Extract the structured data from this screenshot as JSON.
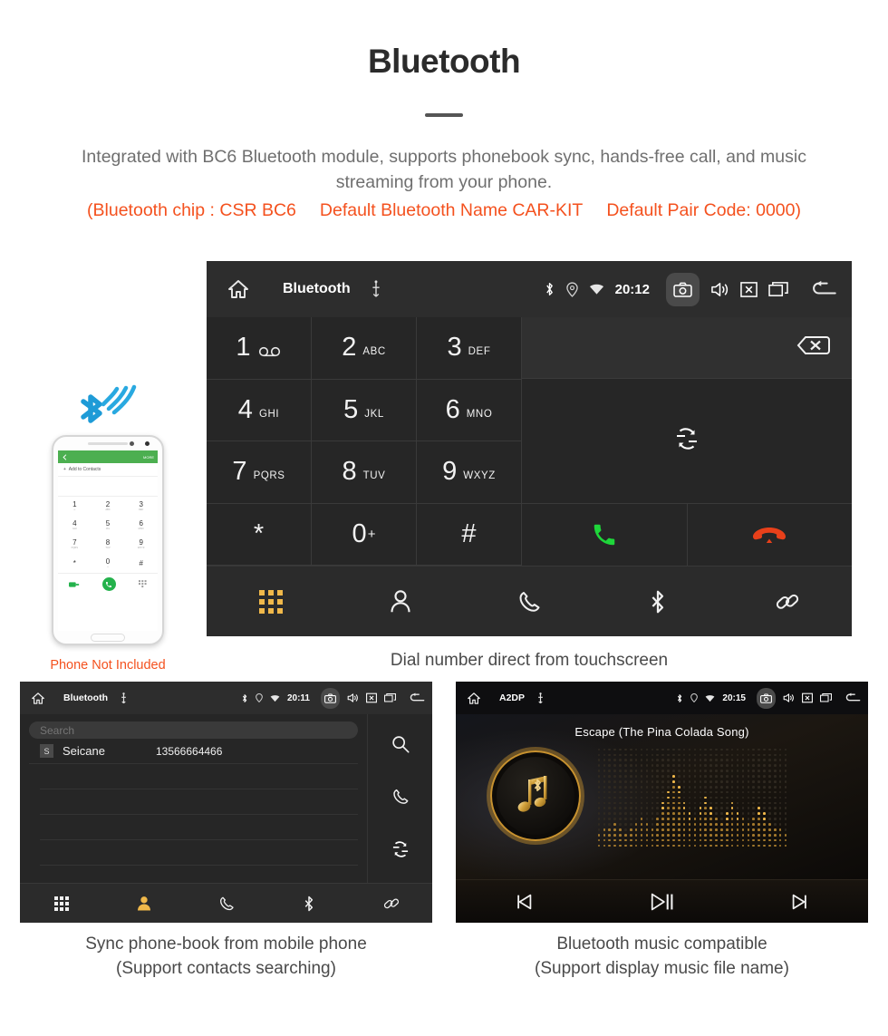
{
  "header": {
    "title": "Bluetooth",
    "description": "Integrated with BC6 Bluetooth module, supports phonebook sync, hands-free call, and music streaming from your phone.",
    "spec_open": "(Bluetooth chip : CSR BC6",
    "spec_name": "Default Bluetooth Name CAR-KIT",
    "spec_pair": "Default Pair Code: 0000)",
    "accent_color": "#f4511e",
    "body_color": "#6f6f6f"
  },
  "dialer": {
    "statusbar": {
      "home_icon": "home-icon",
      "title": "Bluetooth",
      "usb_icon": "usb-icon",
      "bluetooth_icon": "bluetooth-icon",
      "location_icon": "location-icon",
      "wifi_icon": "wifi-icon",
      "time": "20:12",
      "camera_icon": "camera-icon",
      "volume_icon": "volume-icon",
      "close_icon": "close-box-icon",
      "recents_icon": "recent-apps-icon",
      "back_icon": "back-icon"
    },
    "keys": [
      {
        "digit": "1",
        "letters": "",
        "icon": "voicemail-icon"
      },
      {
        "digit": "2",
        "letters": "ABC",
        "icon": ""
      },
      {
        "digit": "3",
        "letters": "DEF",
        "icon": ""
      },
      {
        "digit": "4",
        "letters": "GHI",
        "icon": ""
      },
      {
        "digit": "5",
        "letters": "JKL",
        "icon": ""
      },
      {
        "digit": "6",
        "letters": "MNO",
        "icon": ""
      },
      {
        "digit": "7",
        "letters": "PQRS",
        "icon": ""
      },
      {
        "digit": "8",
        "letters": "TUV",
        "icon": ""
      },
      {
        "digit": "9",
        "letters": "WXYZ",
        "icon": ""
      },
      {
        "digit": "*",
        "letters": "",
        "icon": ""
      },
      {
        "digit": "0",
        "letters": "",
        "icon": "plus-superscript"
      },
      {
        "digit": "#",
        "letters": "",
        "icon": ""
      }
    ],
    "backspace_icon": "backspace-icon",
    "sync_icon": "sync-icon",
    "call_icon": "call-icon",
    "hangup_icon": "hangup-icon",
    "call_color": "#1ed63a",
    "hangup_color": "#e8401a",
    "tabs": [
      {
        "name": "dialpad",
        "icon": "dialpad-grid-icon",
        "active": true
      },
      {
        "name": "contacts",
        "icon": "person-icon",
        "active": false
      },
      {
        "name": "call-history",
        "icon": "handset-icon",
        "active": false
      },
      {
        "name": "bluetooth",
        "icon": "bluetooth-icon",
        "active": false
      },
      {
        "name": "pair-link",
        "icon": "link-icon",
        "active": false
      }
    ],
    "active_tab_color": "#f0b84a",
    "caption": "Dial number direct from touchscreen"
  },
  "phone_mock": {
    "bar_back_icon": "back-arrow-icon",
    "bar_more": "MORE",
    "add_to_contacts": "Add to Contacts",
    "keys": [
      {
        "digit": "1",
        "letters": "∞"
      },
      {
        "digit": "2",
        "letters": "ABC"
      },
      {
        "digit": "3",
        "letters": "DEF"
      },
      {
        "digit": "4",
        "letters": "GHI"
      },
      {
        "digit": "5",
        "letters": "JKL"
      },
      {
        "digit": "6",
        "letters": "MNO"
      },
      {
        "digit": "7",
        "letters": "PQRS"
      },
      {
        "digit": "8",
        "letters": "TUV"
      },
      {
        "digit": "9",
        "letters": "WXYZ"
      },
      {
        "digit": "*",
        "letters": ""
      },
      {
        "digit": "0",
        "letters": "+"
      },
      {
        "digit": "#",
        "letters": ""
      }
    ],
    "label": "Phone Not Included",
    "label_color": "#f4511e",
    "bluetooth_badge_color": "#1e9bd7"
  },
  "contacts": {
    "statusbar": {
      "title": "Bluetooth",
      "time": "20:11"
    },
    "search_placeholder": "Search",
    "rows": [
      {
        "avatar": "S",
        "name": "Seicane",
        "number": "13566664466"
      }
    ],
    "rail": [
      {
        "name": "search",
        "icon": "search-icon"
      },
      {
        "name": "call",
        "icon": "handset-icon"
      },
      {
        "name": "sync",
        "icon": "sync-icon"
      }
    ],
    "tabs": [
      {
        "name": "dialpad",
        "icon": "dialpad-grid-icon",
        "active": false
      },
      {
        "name": "contacts",
        "icon": "person-icon",
        "active": true
      },
      {
        "name": "call-history",
        "icon": "handset-icon",
        "active": false
      },
      {
        "name": "bluetooth",
        "icon": "bluetooth-icon",
        "active": false
      },
      {
        "name": "pair-link",
        "icon": "link-icon",
        "active": false
      }
    ],
    "caption_line1": "Sync phone-book from mobile phone",
    "caption_line2": "(Support contacts searching)"
  },
  "music": {
    "statusbar": {
      "title": "A2DP",
      "time": "20:15"
    },
    "track_title": "Escape (The Pina Colada Song)",
    "album_icon": "music-note-bluetooth-icon",
    "controls": [
      {
        "name": "previous",
        "icon": "skip-previous-icon"
      },
      {
        "name": "play-pause",
        "icon": "play-pause-icon"
      },
      {
        "name": "next",
        "icon": "skip-next-icon"
      }
    ],
    "accent_color": "#c8922f",
    "caption_line1": "Bluetooth music compatible",
    "caption_line2": "(Support display music file name)"
  }
}
